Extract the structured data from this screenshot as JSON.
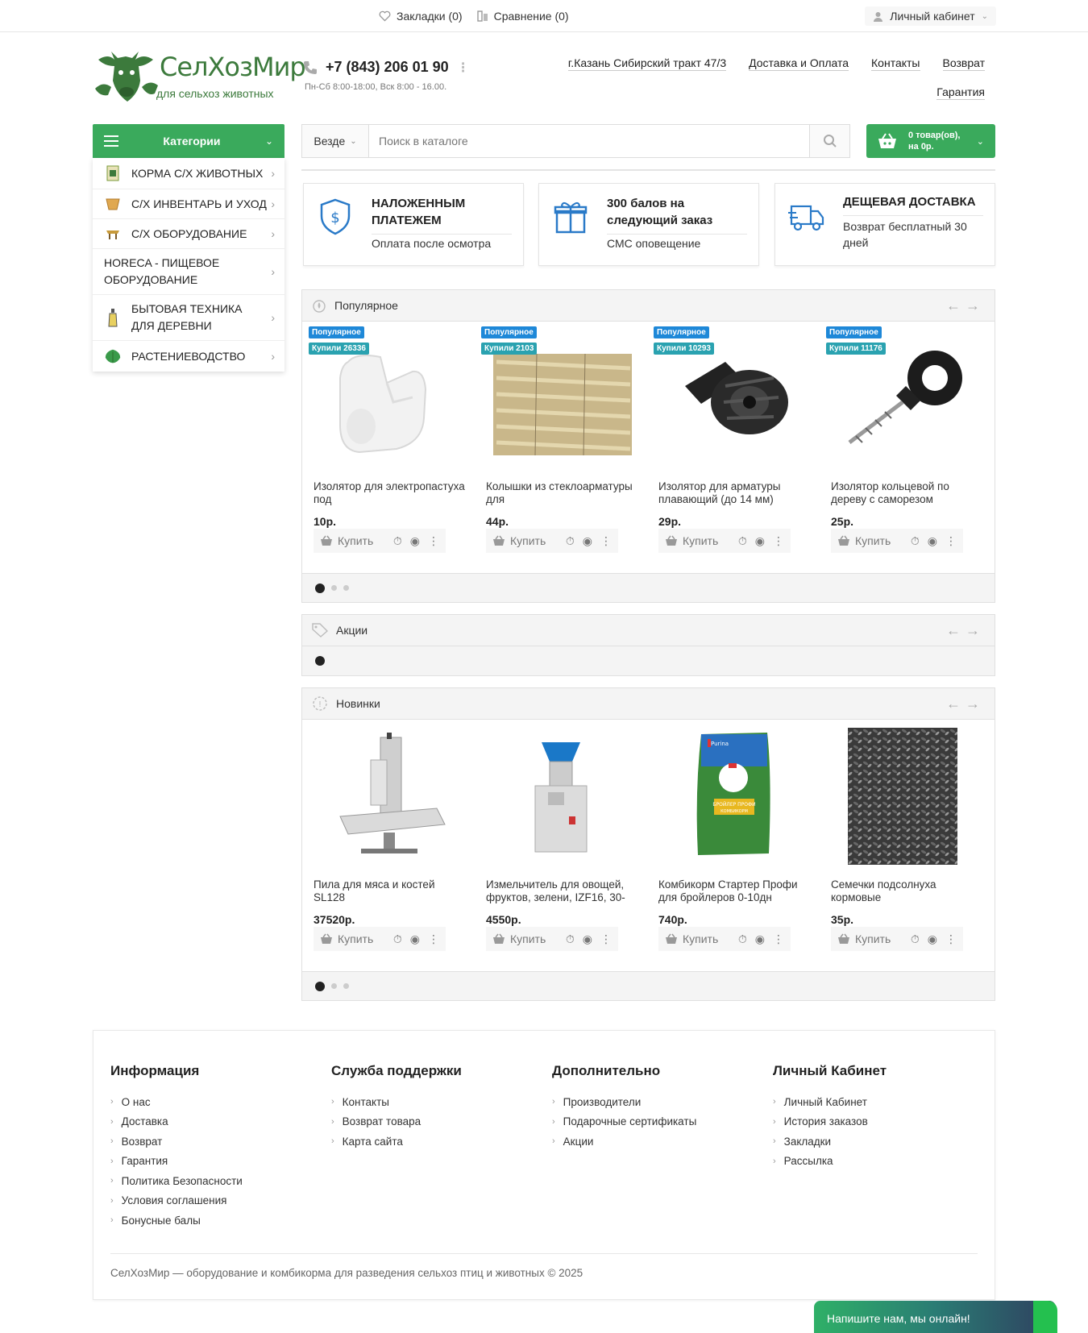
{
  "topbar": {
    "bookmarks": "Закладки (0)",
    "compare": "Сравнение (0)",
    "account": "Личный кабинет"
  },
  "header": {
    "logo_title": "СелХозМир",
    "logo_subtitle": "для сельхоз животных",
    "phone": "+7 (843) 206 01 90",
    "hours": "Пн-Сб 8:00-18:00, Вск 8:00 - 16.00.",
    "links": [
      "г.Казань Сибирский тракт 47/3",
      "Доставка и Оплата",
      "Контакты",
      "Возврат",
      "Гарантия"
    ]
  },
  "categories": {
    "title": "Категории",
    "items": [
      {
        "label": "КОРМА С/Х ЖИВОТНЫХ",
        "icon": "feed-bag-icon"
      },
      {
        "label": "С/Х ИНВЕНТАРЬ И УХОД",
        "icon": "bucket-icon"
      },
      {
        "label": "С/Х ОБОРУДОВАНИЕ",
        "icon": "equipment-icon"
      },
      {
        "label": "HORECA - ПИЩЕВОЕ ОБОРУДОВАНИЕ",
        "icon": ""
      },
      {
        "label": "БЫТОВАЯ ТЕХНИКА ДЛЯ ДЕРЕВНИ",
        "icon": "bottle-icon"
      },
      {
        "label": "РАСТЕНИЕВОДСТВО",
        "icon": "leaf-icon"
      }
    ]
  },
  "search": {
    "scope": "Везде",
    "placeholder": "Поиск в каталоге"
  },
  "cart": {
    "line1": "0 товар(ов),",
    "line2": "на 0р."
  },
  "benefits": [
    {
      "title": "НАЛОЖЕННЫМ ПЛАТЕЖЕМ",
      "subtitle": "Оплата после осмотра",
      "icon": "shield-dollar-icon"
    },
    {
      "title": "300 балов на следующий заказ",
      "subtitle": "СМС оповещение",
      "icon": "gift-icon"
    },
    {
      "title": "ДЕЩЕВАЯ ДОСТАВКА",
      "subtitle": "Возврат бесплатный 30 дней",
      "icon": "truck-icon"
    }
  ],
  "popular": {
    "title": "Популярное",
    "products": [
      {
        "badge": "Популярное",
        "bought": "Купили 26336",
        "name": "Изолятор для электропастуха под",
        "price": "10р.",
        "buy": "Купить"
      },
      {
        "badge": "Популярное",
        "bought": "Купили 2103",
        "name": "Колышки из стеклоарматуры для",
        "price": "44р.",
        "buy": "Купить"
      },
      {
        "badge": "Популярное",
        "bought": "Купили 10293",
        "name": "Изолятор для арматуры плавающий (до 14 мм)",
        "price": "29р.",
        "buy": "Купить"
      },
      {
        "badge": "Популярное",
        "bought": "Купили 11176",
        "name": "Изолятор кольцевой по дереву с саморезом",
        "price": "25р.",
        "buy": "Купить"
      }
    ]
  },
  "promo": {
    "title": "Акции"
  },
  "new": {
    "title": "Новинки",
    "products": [
      {
        "name": "Пила для мяса и костей SL128",
        "price": "37520р.",
        "buy": "Купить"
      },
      {
        "name": "Измельчитель для овощей, фруктов, зелени, IZF16, 30-",
        "price": "4550р.",
        "buy": "Купить"
      },
      {
        "name": "Комбикорм Стартер Профи для бройлеров 0-10дн",
        "price": "740р.",
        "buy": "Купить",
        "bag_brand": "Purina",
        "bag_label": "БРОЙЛЕР ПРОФИ",
        "bag_sub": "КОМБИКОРМ"
      },
      {
        "name": "Семечки подсолнуха кормовые",
        "price": "35р.",
        "buy": "Купить"
      }
    ]
  },
  "footer": {
    "columns": [
      {
        "title": "Информация",
        "items": [
          "О нас",
          "Доставка",
          "Возврат",
          "Гарантия",
          "Политика Безопасности",
          "Условия соглашения",
          "Бонусные балы"
        ]
      },
      {
        "title": "Служба поддержки",
        "items": [
          "Контакты",
          "Возврат товара",
          "Карта сайта"
        ]
      },
      {
        "title": "Дополнительно",
        "items": [
          "Производители",
          "Подарочные сертификаты",
          "Акции"
        ]
      },
      {
        "title": "Личный Кабинет",
        "items": [
          "Личный Кабинет",
          "История заказов",
          "Закладки",
          "Рассылка"
        ]
      }
    ],
    "copyright": "СелХозМир — оборудование и комбикорма для разведения сельхоз птиц и животных © 2025"
  },
  "chat": {
    "label": "Напишите нам, мы онлайн!"
  },
  "colors": {
    "brand_green": "#3aaa5c",
    "logo_green": "#3c7a3c",
    "badge_blue": "#1e88d8",
    "badge_teal": "#2aa2b0"
  }
}
